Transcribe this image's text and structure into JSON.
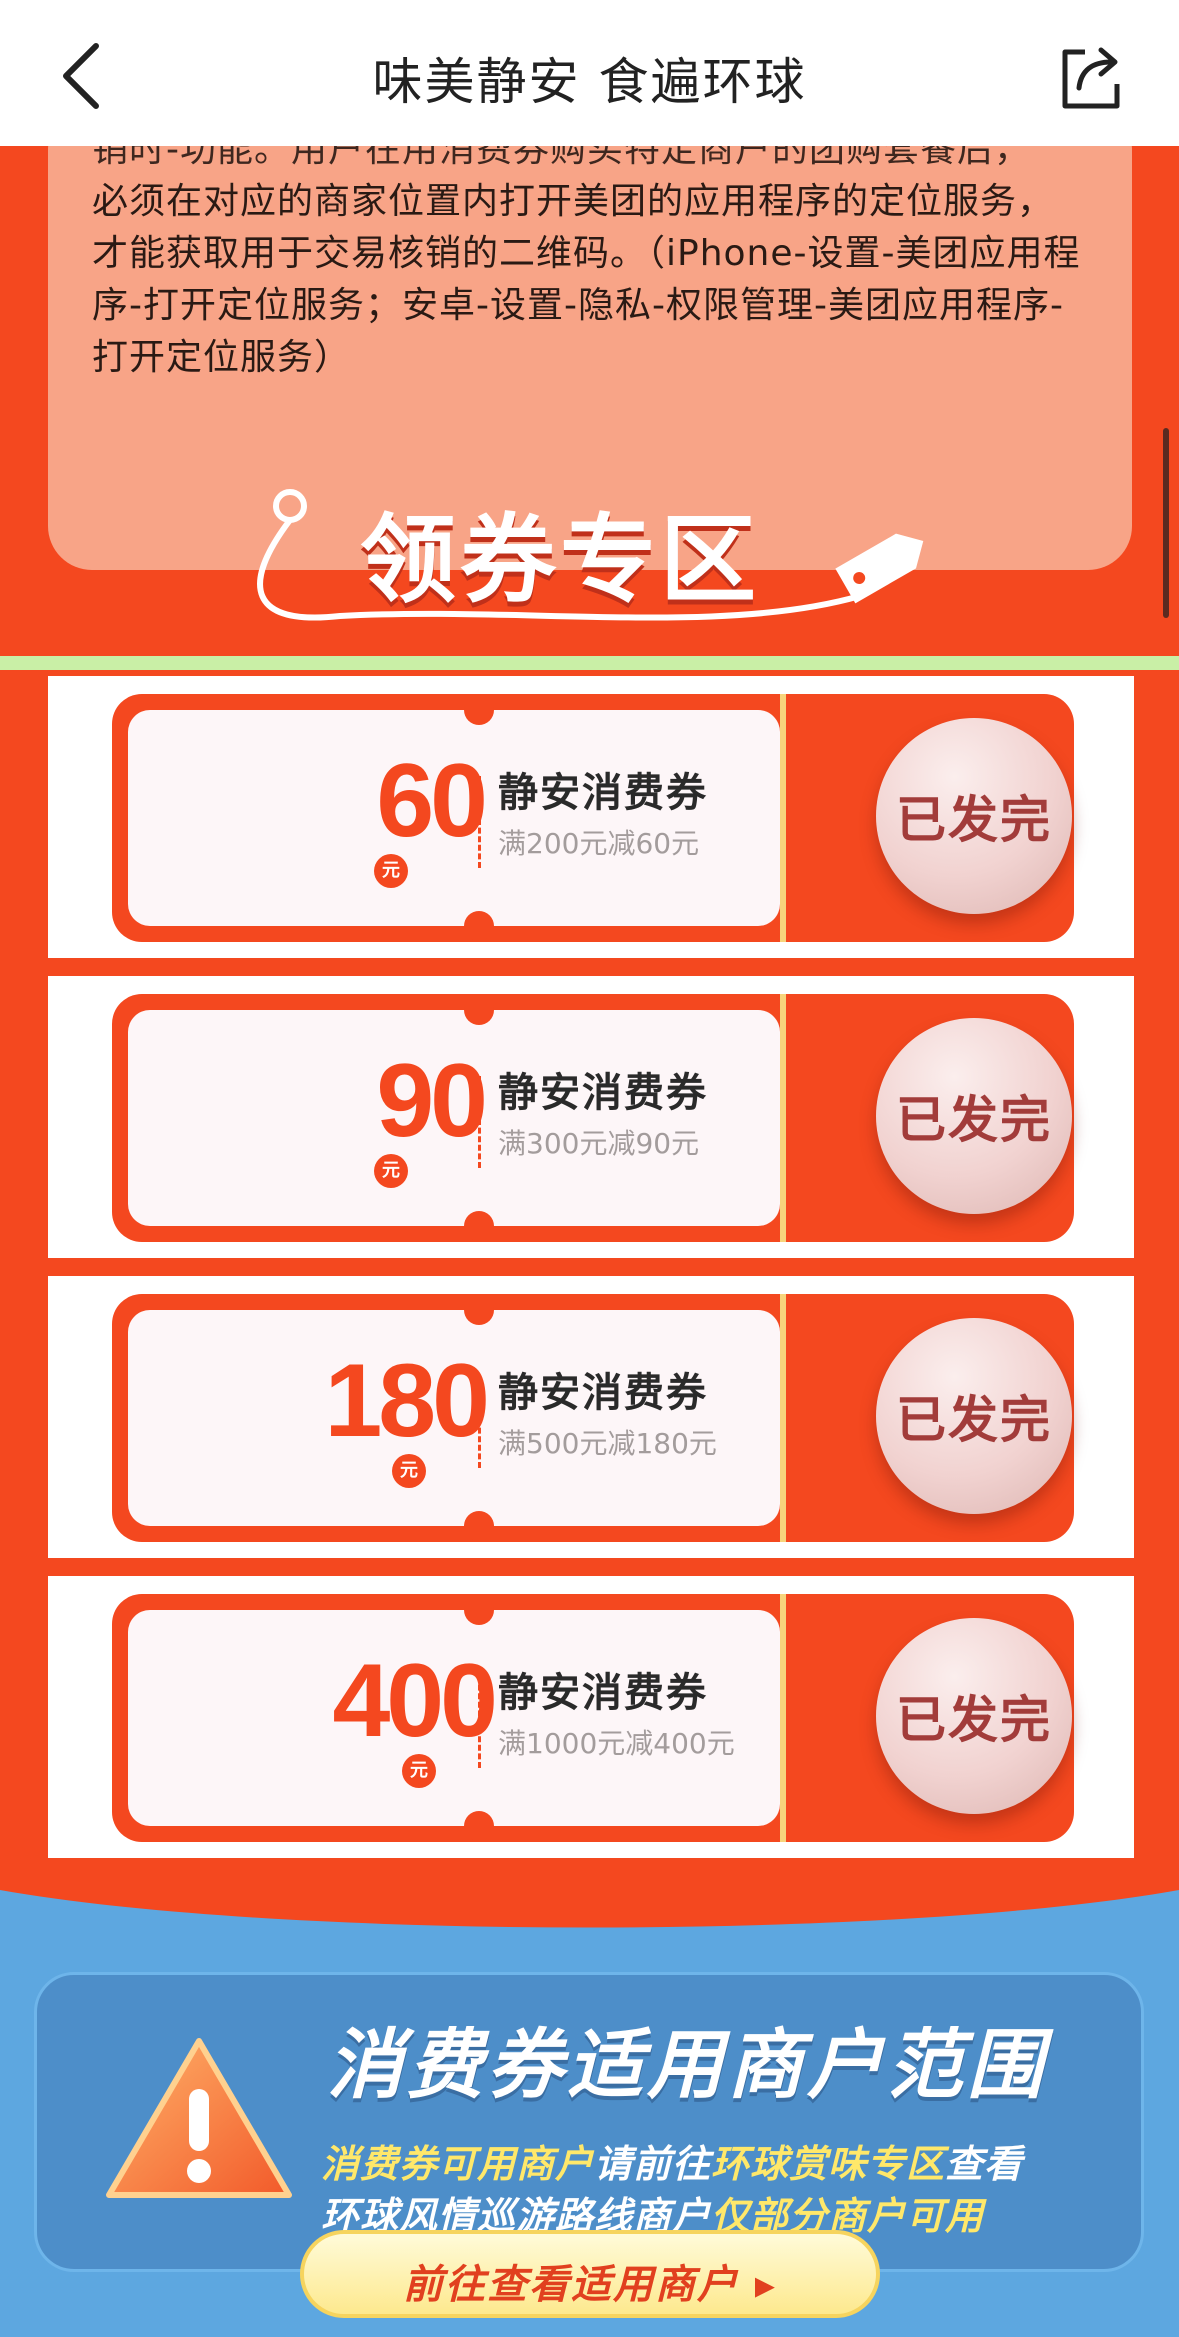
{
  "nav": {
    "title": "味美静安 食遍环球",
    "back_icon": "chevron-left-icon",
    "share_icon": "share-icon"
  },
  "notice": {
    "cut_line": "销时-功能。用户在用消费券购买特定商户的团购套餐后，",
    "body": "必须在对应的商家位置内打开美团的应用程序的定位服务，才能获取用于交易核销的二维码。（iPhone-设置-美团应用程序-打开定位服务；安卓-设置-隐私-权限管理-美团应用程序-打开定位服务）"
  },
  "coupon_zone": {
    "title": "领券专区"
  },
  "coupons": [
    {
      "amount": "60",
      "unit": "元",
      "name": "静安消费券",
      "condition": "满200元减60元",
      "status": "已发完"
    },
    {
      "amount": "90",
      "unit": "元",
      "name": "静安消费券",
      "condition": "满300元减90元",
      "status": "已发完"
    },
    {
      "amount": "180",
      "unit": "元",
      "name": "静安消费券",
      "condition": "满500元减180元",
      "status": "已发完"
    },
    {
      "amount": "400",
      "unit": "元",
      "name": "静安消费券",
      "condition": "满1000元减400元",
      "status": "已发完"
    }
  ],
  "scope": {
    "heading": "消费券适用商户范围",
    "line1_hl1": "消费券可用商户",
    "line1_mid": "请前往",
    "line1_hl2": "环球赏味专区",
    "line1_end": "查看",
    "line2_start": "环球风情巡游路线商户",
    "line2_hl": "仅部分商户可用",
    "button": "前往查看适用商户 ▸",
    "warn_icon": "warning-icon"
  },
  "colors": {
    "brand_red": "#f4481f",
    "notice_bg": "#f8a487",
    "blue_bg": "#5da7e0",
    "highlight_yellow": "#ffe86a"
  }
}
